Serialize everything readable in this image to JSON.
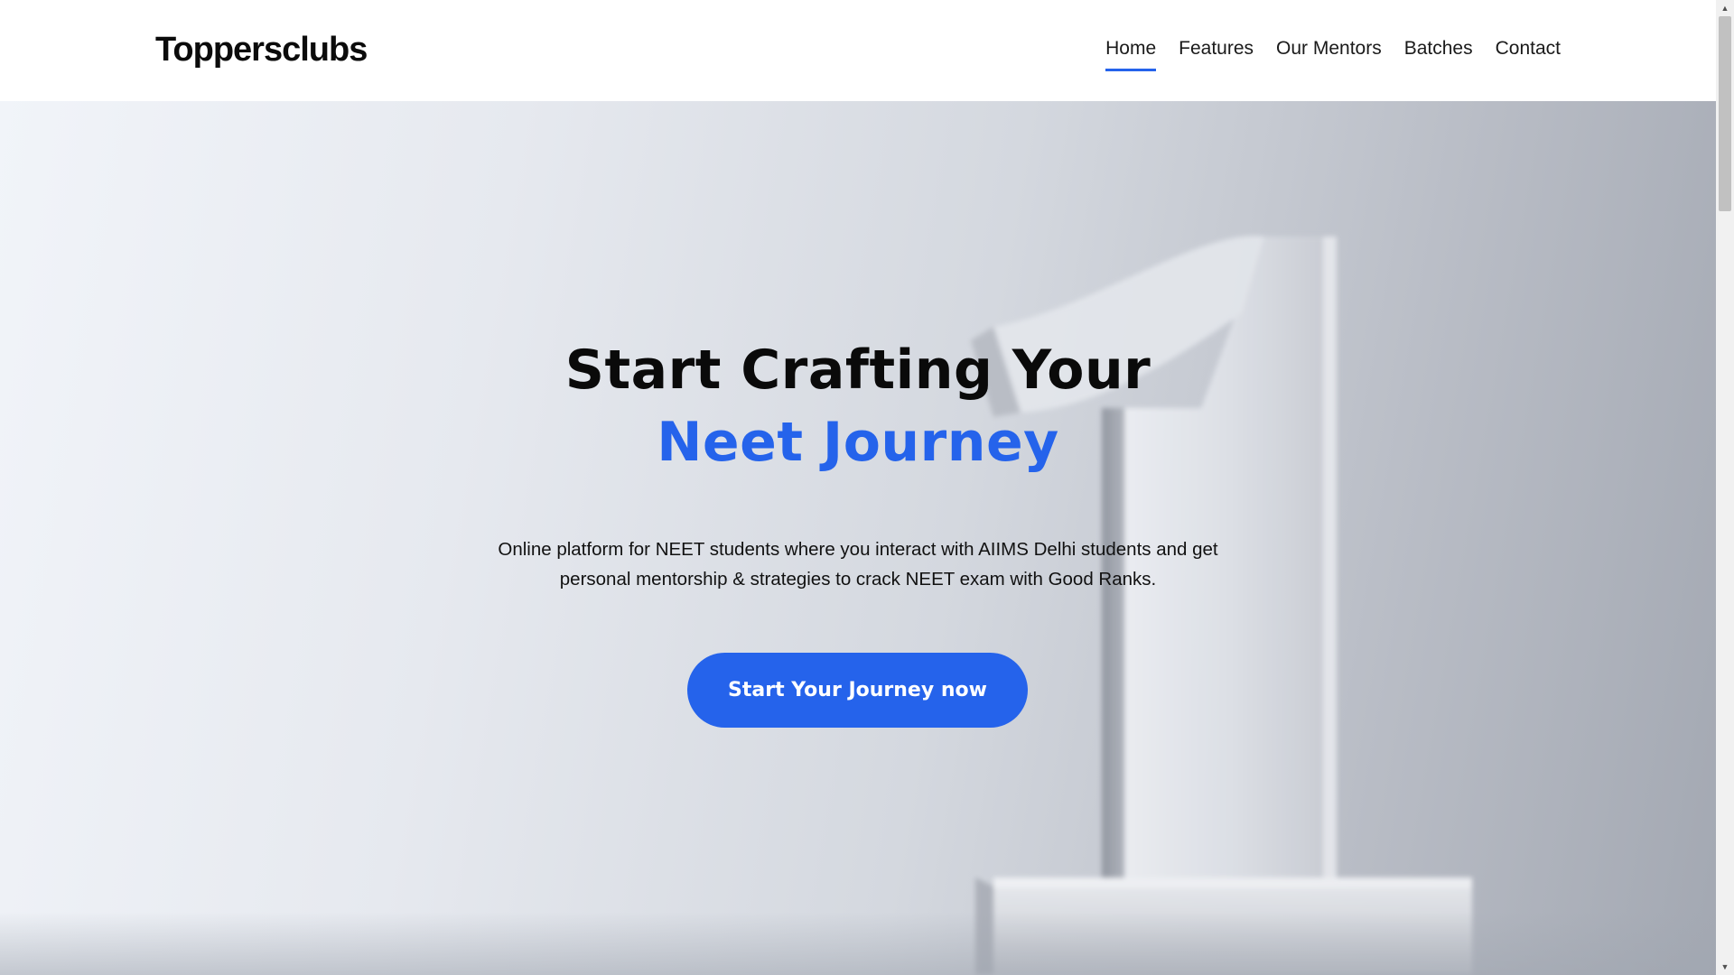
{
  "header": {
    "brand": "Toppersclubs",
    "nav": [
      {
        "label": "Home",
        "active": true
      },
      {
        "label": "Features",
        "active": false
      },
      {
        "label": "Our Mentors",
        "active": false
      },
      {
        "label": "Batches",
        "active": false
      },
      {
        "label": "Contact",
        "active": false
      }
    ]
  },
  "hero": {
    "headline_line1": "Start Crafting Your",
    "headline_line2": "Neet Journey",
    "subtitle": "Online platform for NEET students where you interact with AIIMS Delhi students and get personal mentorship & strategies to crack NEET exam with Good Ranks.",
    "cta_label": "Start Your Journey now"
  },
  "colors": {
    "accent": "#2563eb",
    "text": "#0a0a0a",
    "header_bg": "#ffffff"
  },
  "icons": {
    "scroll_up": "triangle-up-icon",
    "scroll_down": "triangle-down-icon"
  }
}
